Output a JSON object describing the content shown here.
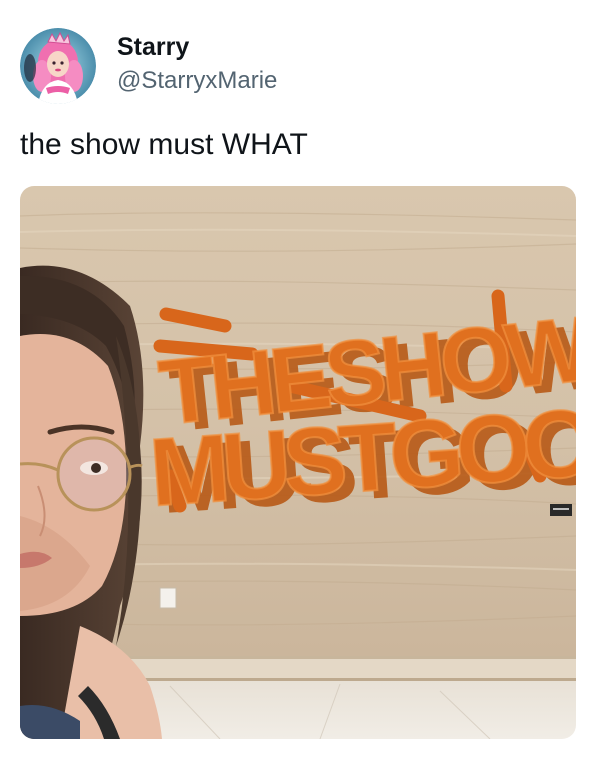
{
  "author": {
    "display_name": "Starry",
    "handle": "@StarryxMarie",
    "avatar_icon": "profile-avatar"
  },
  "tweet": {
    "text": "the show must WHAT"
  },
  "photo": {
    "sign_text": "THE SHOW MUST GO ON",
    "sign_color": "#e0701f",
    "wall_color": "#d8c5ab"
  }
}
